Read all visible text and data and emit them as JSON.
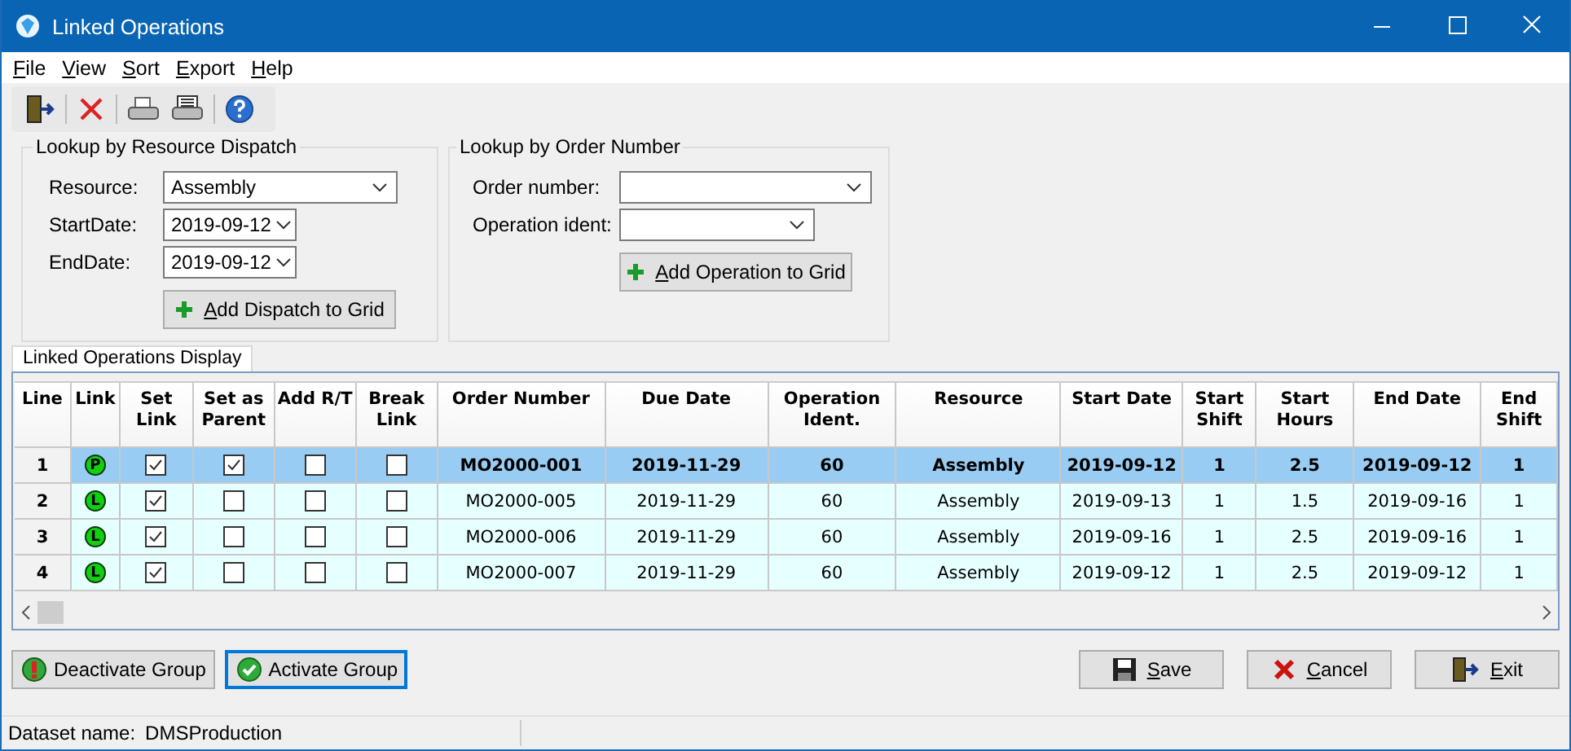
{
  "window": {
    "title": "Linked Operations"
  },
  "menu": [
    {
      "label": "File"
    },
    {
      "label": "View"
    },
    {
      "label": "Sort"
    },
    {
      "label": "Export"
    },
    {
      "label": "Help"
    }
  ],
  "resource_lookup": {
    "title": "Lookup by Resource Dispatch",
    "resource_label": "Resource:",
    "resource": "Assembly",
    "start_label": "StartDate:",
    "start_date": "2019-09-12",
    "end_label": "EndDate:",
    "end_date": "2019-09-12",
    "button": "Add Dispatch to Grid"
  },
  "order_lookup": {
    "title": "Lookup by Order Number",
    "order_label": "Order number:",
    "operation_label": "Operation ident:",
    "button": "Add Operation to Grid"
  },
  "tabs": [
    {
      "label": "Linked Operations Display",
      "selected": true
    }
  ],
  "table": {
    "columns": [
      "Line",
      "Link",
      "Set Link",
      "Set as Parent",
      "Add R/T",
      "Break Link",
      "Order Number",
      "Due Date",
      "Operation Ident.",
      "Resource",
      "Start Date",
      "Start Shift",
      "Start Hours",
      "End Date",
      "End Shift"
    ],
    "rows": [
      {
        "line": "1",
        "link": "P",
        "set_link": true,
        "set_as_parent": true,
        "add_rt": false,
        "break_link": false,
        "selected": true,
        "order_number": "MO2000-001",
        "due_date": "2019-11-29",
        "operation_ident": "60",
        "resource": "Assembly",
        "start_date": "2019-09-12",
        "start_shift": "1",
        "start_hours": "2.5",
        "end_date": "2019-09-12",
        "end_shift": "1"
      },
      {
        "line": "2",
        "link": "L",
        "set_link": true,
        "set_as_parent": false,
        "add_rt": false,
        "break_link": false,
        "selected": false,
        "order_number": "MO2000-005",
        "due_date": "2019-11-29",
        "operation_ident": "60",
        "resource": "Assembly",
        "start_date": "2019-09-13",
        "start_shift": "1",
        "start_hours": "1.5",
        "end_date": "2019-09-16",
        "end_shift": "1"
      },
      {
        "line": "3",
        "link": "L",
        "set_link": true,
        "set_as_parent": false,
        "add_rt": false,
        "break_link": false,
        "selected": false,
        "order_number": "MO2000-006",
        "due_date": "2019-11-29",
        "operation_ident": "60",
        "resource": "Assembly",
        "start_date": "2019-09-16",
        "start_shift": "1",
        "start_hours": "2.5",
        "end_date": "2019-09-16",
        "end_shift": "1"
      },
      {
        "line": "4",
        "link": "L",
        "set_link": true,
        "set_as_parent": false,
        "add_rt": false,
        "break_link": false,
        "selected": false,
        "order_number": "MO2000-007",
        "due_date": "2019-11-29",
        "operation_ident": "60",
        "resource": "Assembly",
        "start_date": "2019-09-12",
        "start_shift": "1",
        "start_hours": "2.5",
        "end_date": "2019-09-12",
        "end_shift": "1"
      }
    ]
  },
  "group_buttons": [
    {
      "label": "Deactivate Group",
      "kind": "deactivate",
      "focused": false
    },
    {
      "label": "Activate Group",
      "kind": "activate",
      "focused": true
    }
  ],
  "action_buttons": [
    {
      "label": "Save",
      "kind": "save"
    },
    {
      "label": "Cancel",
      "kind": "cancel"
    },
    {
      "label": "Exit",
      "kind": "exit"
    }
  ],
  "status_bar": {
    "label": "Dataset name:",
    "value": "DMSProduction"
  }
}
